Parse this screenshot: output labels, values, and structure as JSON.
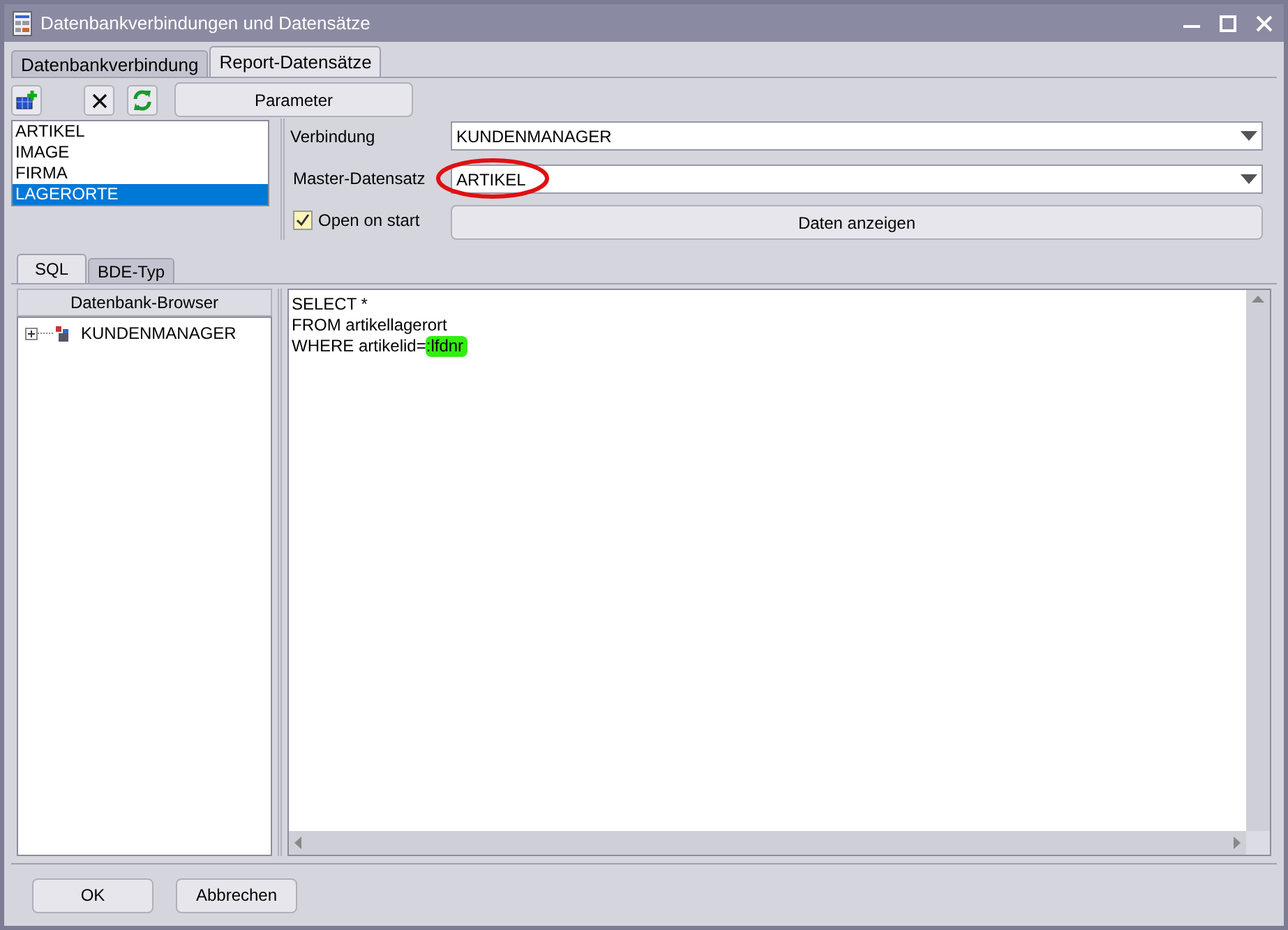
{
  "window": {
    "title": "Datenbankverbindungen und Datensätze"
  },
  "tabs": [
    {
      "label": "Datenbankverbindung",
      "selected": false
    },
    {
      "label": "Report-Datensätze",
      "selected": true
    }
  ],
  "toolbar": {
    "parameter_button": "Parameter"
  },
  "datasets": [
    {
      "label": "ARTIKEL",
      "selected": false
    },
    {
      "label": "IMAGE",
      "selected": false
    },
    {
      "label": "FIRMA",
      "selected": false
    },
    {
      "label": "LAGERORTE",
      "selected": true
    }
  ],
  "connection": {
    "label": "Verbindung",
    "value": "KUNDENMANAGER"
  },
  "master": {
    "label": "Master-Datensatz",
    "value": "ARTIKEL"
  },
  "open_on_start": {
    "label": "Open on start",
    "checked": true
  },
  "show_data_button": "Daten anzeigen",
  "sub_tabs": [
    {
      "label": "SQL",
      "selected": true
    },
    {
      "label": "BDE-Typ",
      "selected": false
    }
  ],
  "browser": {
    "header": "Datenbank-Browser",
    "tree": [
      {
        "label": "KUNDENMANAGER",
        "expanded": false
      }
    ]
  },
  "sql": [
    [
      {
        "text": "SELECT *",
        "highlighted": false
      }
    ],
    [
      {
        "text": "FROM artikellagerort",
        "highlighted": false
      }
    ],
    [
      {
        "text": "WHERE artikelid=",
        "highlighted": false
      },
      {
        "text": ":lfdnr",
        "highlighted": true
      }
    ]
  ],
  "buttons": [
    "OK",
    "Abbrechen"
  ]
}
